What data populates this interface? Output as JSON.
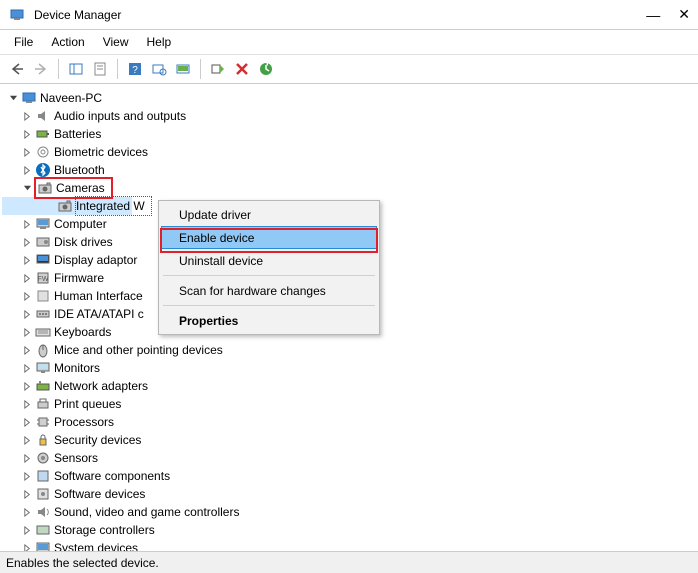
{
  "title": "Device Manager",
  "window_controls": {
    "min": "—",
    "close": "✕"
  },
  "menu": {
    "file": "File",
    "action": "Action",
    "view": "View",
    "help": "Help"
  },
  "root": "Naveen-PC",
  "categories": [
    {
      "label": "Audio inputs and outputs",
      "icon": "audio",
      "expanded": false
    },
    {
      "label": "Batteries",
      "icon": "battery",
      "expanded": false
    },
    {
      "label": "Biometric devices",
      "icon": "biometric",
      "expanded": false
    },
    {
      "label": "Bluetooth",
      "icon": "bluetooth",
      "expanded": false
    },
    {
      "label": "Cameras",
      "icon": "camera",
      "expanded": true,
      "highlight_box": true,
      "children": [
        {
          "label": "Integrated W",
          "icon": "camera",
          "selected": true
        }
      ]
    },
    {
      "label": "Computer",
      "icon": "computer",
      "expanded": false
    },
    {
      "label": "Disk drives",
      "icon": "disk",
      "expanded": false
    },
    {
      "label": "Display adaptor",
      "icon": "display",
      "expanded": false,
      "truncated": true
    },
    {
      "label": "Firmware",
      "icon": "firmware",
      "expanded": false
    },
    {
      "label": "Human Interface",
      "icon": "hid",
      "expanded": false,
      "truncated": true
    },
    {
      "label": "IDE ATA/ATAPI c",
      "icon": "ide",
      "expanded": false,
      "truncated": true
    },
    {
      "label": "Keyboards",
      "icon": "keyboard",
      "expanded": false
    },
    {
      "label": "Mice and other pointing devices",
      "icon": "mouse",
      "expanded": false
    },
    {
      "label": "Monitors",
      "icon": "monitor",
      "expanded": false
    },
    {
      "label": "Network adapters",
      "icon": "network",
      "expanded": false
    },
    {
      "label": "Print queues",
      "icon": "printer",
      "expanded": false
    },
    {
      "label": "Processors",
      "icon": "cpu",
      "expanded": false
    },
    {
      "label": "Security devices",
      "icon": "security",
      "expanded": false
    },
    {
      "label": "Sensors",
      "icon": "sensor",
      "expanded": false
    },
    {
      "label": "Software components",
      "icon": "softcomp",
      "expanded": false
    },
    {
      "label": "Software devices",
      "icon": "softdev",
      "expanded": false
    },
    {
      "label": "Sound, video and game controllers",
      "icon": "sound",
      "expanded": false
    },
    {
      "label": "Storage controllers",
      "icon": "storage",
      "expanded": false
    },
    {
      "label": "System devices",
      "icon": "system",
      "expanded": false,
      "cutoff": true
    }
  ],
  "context_menu": {
    "items": [
      {
        "label": "Update driver"
      },
      {
        "label": "Enable device",
        "highlighted": true,
        "highlight_box": true
      },
      {
        "label": "Uninstall device"
      },
      {
        "sep": true
      },
      {
        "label": "Scan for hardware changes"
      },
      {
        "sep": true
      },
      {
        "label": "Properties",
        "bold": true
      }
    ]
  },
  "status": "Enables the selected device."
}
